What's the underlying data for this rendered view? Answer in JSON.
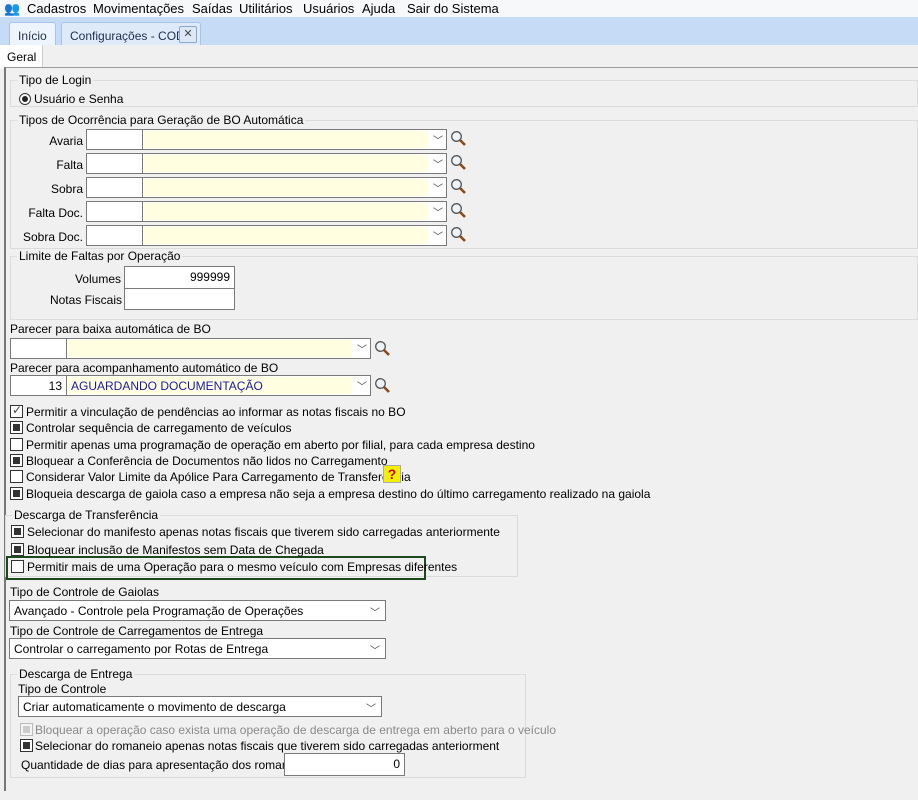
{
  "menu": [
    "Cadastros",
    "Movimentações",
    "Saídas",
    "Utilitários",
    "Usuários",
    "Ajuda",
    "Sair do Sistema"
  ],
  "tabs": [
    {
      "label": "Início"
    },
    {
      "label": "Configurações - COD"
    }
  ],
  "subtab": "Geral",
  "tipo_login": {
    "title": "Tipo de Login",
    "option": "Usuário e Senha",
    "selected": true
  },
  "ocorrencias": {
    "title": "Tipos de Ocorrência para Geração de BO Automática",
    "rows": [
      {
        "label": "Avaria",
        "code": "",
        "value": ""
      },
      {
        "label": "Falta",
        "code": "",
        "value": ""
      },
      {
        "label": "Sobra",
        "code": "",
        "value": ""
      },
      {
        "label": "Falta Doc.",
        "code": "",
        "value": ""
      },
      {
        "label": "Sobra Doc.",
        "code": "",
        "value": ""
      }
    ]
  },
  "limite": {
    "title": "Limite de Faltas por Operação",
    "volumes_label": "Volumes",
    "volumes": "999999",
    "notas_label": "Notas Fiscais",
    "notas": ""
  },
  "parecer_baixa": {
    "label": "Parecer para baixa automática de BO",
    "code": "",
    "value": ""
  },
  "parecer_acomp": {
    "label": "Parecer para acompanhamento automático de BO",
    "code": "13",
    "value": "AGUARDANDO DOCUMENTAÇÃO"
  },
  "checks": [
    {
      "label": "Permitir a vinculação de pendências ao informar as notas fiscais no BO",
      "state": "check"
    },
    {
      "label": "Controlar sequência de carregamento de veículos",
      "state": "on"
    },
    {
      "label": "Permitir apenas uma programação de operação em aberto por filial, para cada empresa destino",
      "state": "off"
    },
    {
      "label": "Bloquear a Conferência de Documentos não lidos no Carregamento",
      "state": "on"
    },
    {
      "label": "Considerar Valor Limite da Apólice Para Carregamento de Transferência",
      "state": "off"
    },
    {
      "label": "Bloqueia descarga de gaiola caso a empresa não seja a empresa destino do último carregamento realizado na gaiola",
      "state": "on"
    }
  ],
  "help_icon": "?",
  "descarga_transf": {
    "title": "Descarga de Transferência",
    "checks": [
      {
        "label": "Selecionar do manifesto apenas notas fiscais que tiverem sido carregadas anteriormente",
        "state": "on"
      },
      {
        "label": "Bloquear inclusão de Manifestos sem Data de Chegada",
        "state": "on"
      },
      {
        "label": "Permitir mais de uma Operação para o mesmo veículo com Empresas diferentes",
        "state": "off"
      }
    ]
  },
  "gaiolas": {
    "label": "Tipo de Controle de Gaiolas",
    "value": "Avançado - Controle pela Programação de Operações"
  },
  "carregamentos": {
    "label": "Tipo de Controle de Carregamentos de Entrega",
    "value": "Controlar o carregamento por Rotas de Entrega"
  },
  "descarga_entrega": {
    "title": "Descarga de Entrega",
    "tipo_label": "Tipo de Controle",
    "tipo_value": "Criar automaticamente o movimento de descarga",
    "check_disabled": "Bloquear a operação caso exista uma operação de descarga de entrega em aberto para o veículo",
    "check_romaneio": "Selecionar do romaneio apenas notas fiscais que tiverem sido carregadas anteriorment",
    "dias_label": "Quantidade de dias para apresentação dos romaneios",
    "dias": "0"
  },
  "colors": {
    "highlight": "#1d4a1d",
    "combo_fill": "#fffee0",
    "tabstrip": "#c6dbf6"
  }
}
